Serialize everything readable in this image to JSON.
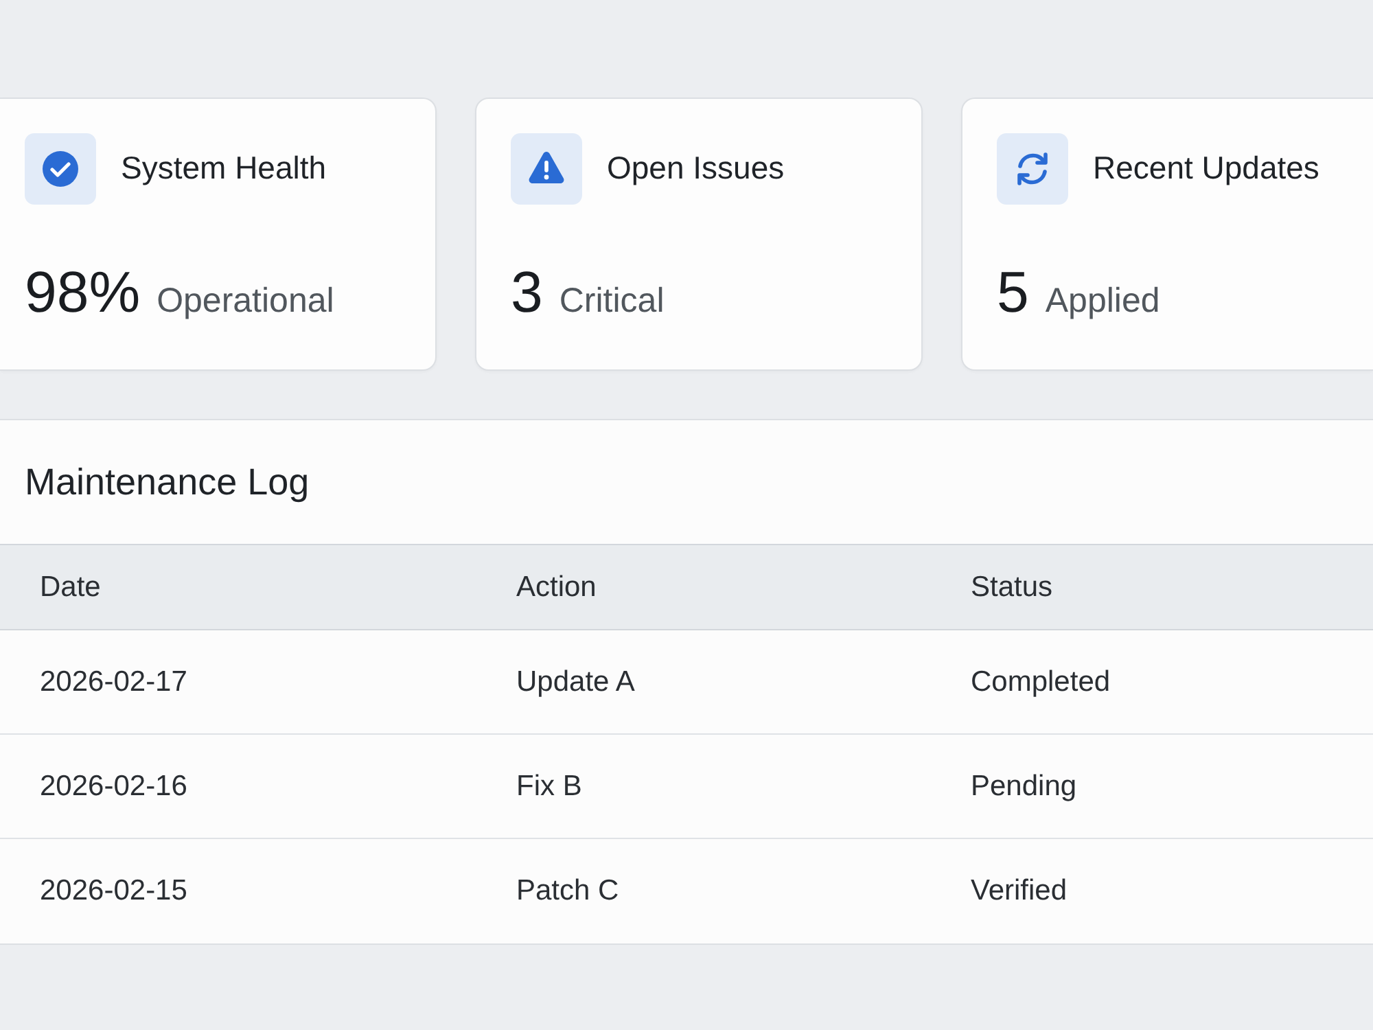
{
  "summary_cards": [
    {
      "title": "System Health",
      "value": "98%",
      "caption": "Operational"
    },
    {
      "title": "Open Issues",
      "value": "3",
      "caption": "Critical"
    },
    {
      "title": "Recent Updates",
      "value": "5",
      "caption": "Applied"
    }
  ],
  "maintenance_log": {
    "title": "Maintenance Log",
    "columns": [
      "Date",
      "Action",
      "Status"
    ],
    "rows": [
      {
        "cells": [
          "2026-02-17",
          "Update A",
          "Completed"
        ]
      },
      {
        "cells": [
          "2026-02-16",
          "Fix B",
          "Pending"
        ]
      },
      {
        "cells": [
          "2026-02-15",
          "Patch C",
          "Verified"
        ]
      }
    ]
  }
}
